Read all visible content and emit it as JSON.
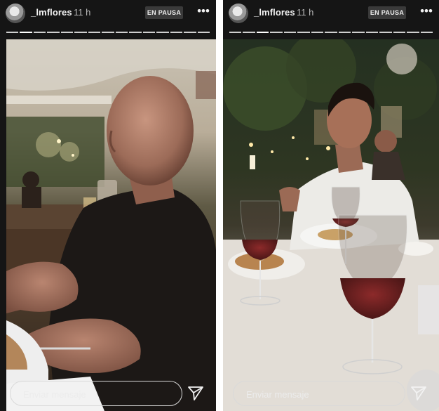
{
  "stories": [
    {
      "username": "_lmflores",
      "time": "11 h",
      "status_badge": "EN PAUSA",
      "reply_placeholder": "Enviar mensaje",
      "icons": {
        "avatar": "profile-avatar",
        "more": "more-options-icon",
        "send": "paper-plane-icon"
      },
      "progress": {
        "segments": 15,
        "active_segment": 1
      }
    },
    {
      "username": "_lmflores",
      "time": "11 h",
      "status_badge": "EN PAUSA",
      "reply_placeholder": "Enviar mensaje",
      "icons": {
        "avatar": "profile-avatar",
        "more": "more-options-icon",
        "send": "paper-plane-icon"
      },
      "progress": {
        "segments": 15,
        "active_segment": 2
      }
    }
  ]
}
